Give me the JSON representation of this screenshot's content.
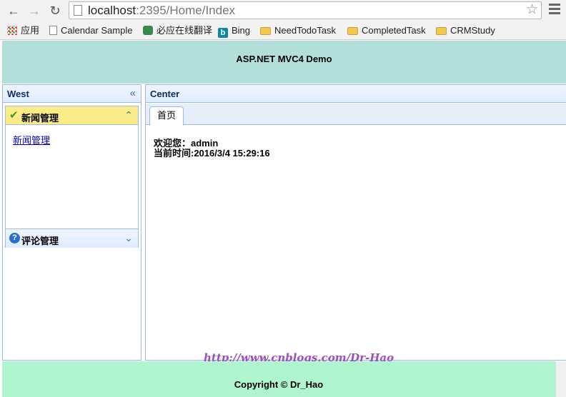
{
  "browser": {
    "url_host": "localhost",
    "url_rest": ":2395/Home/Index",
    "bookmarks": [
      {
        "label": "应用",
        "icon": "apps-icon"
      },
      {
        "label": "Calendar Sample",
        "icon": "page-icon"
      },
      {
        "label": "必应在线翻译",
        "icon": "translate-icon"
      },
      {
        "label": "Bing",
        "icon": "bing-icon"
      },
      {
        "label": "NeedTodoTask",
        "icon": "folder-icon"
      },
      {
        "label": "CompletedTask",
        "icon": "folder-icon"
      },
      {
        "label": "CRMStudy",
        "icon": "folder-icon"
      }
    ]
  },
  "header": {
    "title": "ASP.NET MVC4 Demo",
    "bg": "#b3dfda"
  },
  "west": {
    "title": "West",
    "sections": [
      {
        "title": "新闻管理",
        "items": [
          "新闻管理"
        ]
      },
      {
        "title": "评论管理",
        "items": []
      }
    ]
  },
  "center": {
    "title": "Center",
    "tabs": [
      "首页"
    ],
    "welcome": "欢迎您：admin",
    "time": "当前时间:2016/3/4 15:29:16"
  },
  "watermark": "http://www.cnblogs.com/Dr-Hao",
  "footer": {
    "copyright": "Copyright © Dr_Hao",
    "bg": "#b0f5d0"
  }
}
